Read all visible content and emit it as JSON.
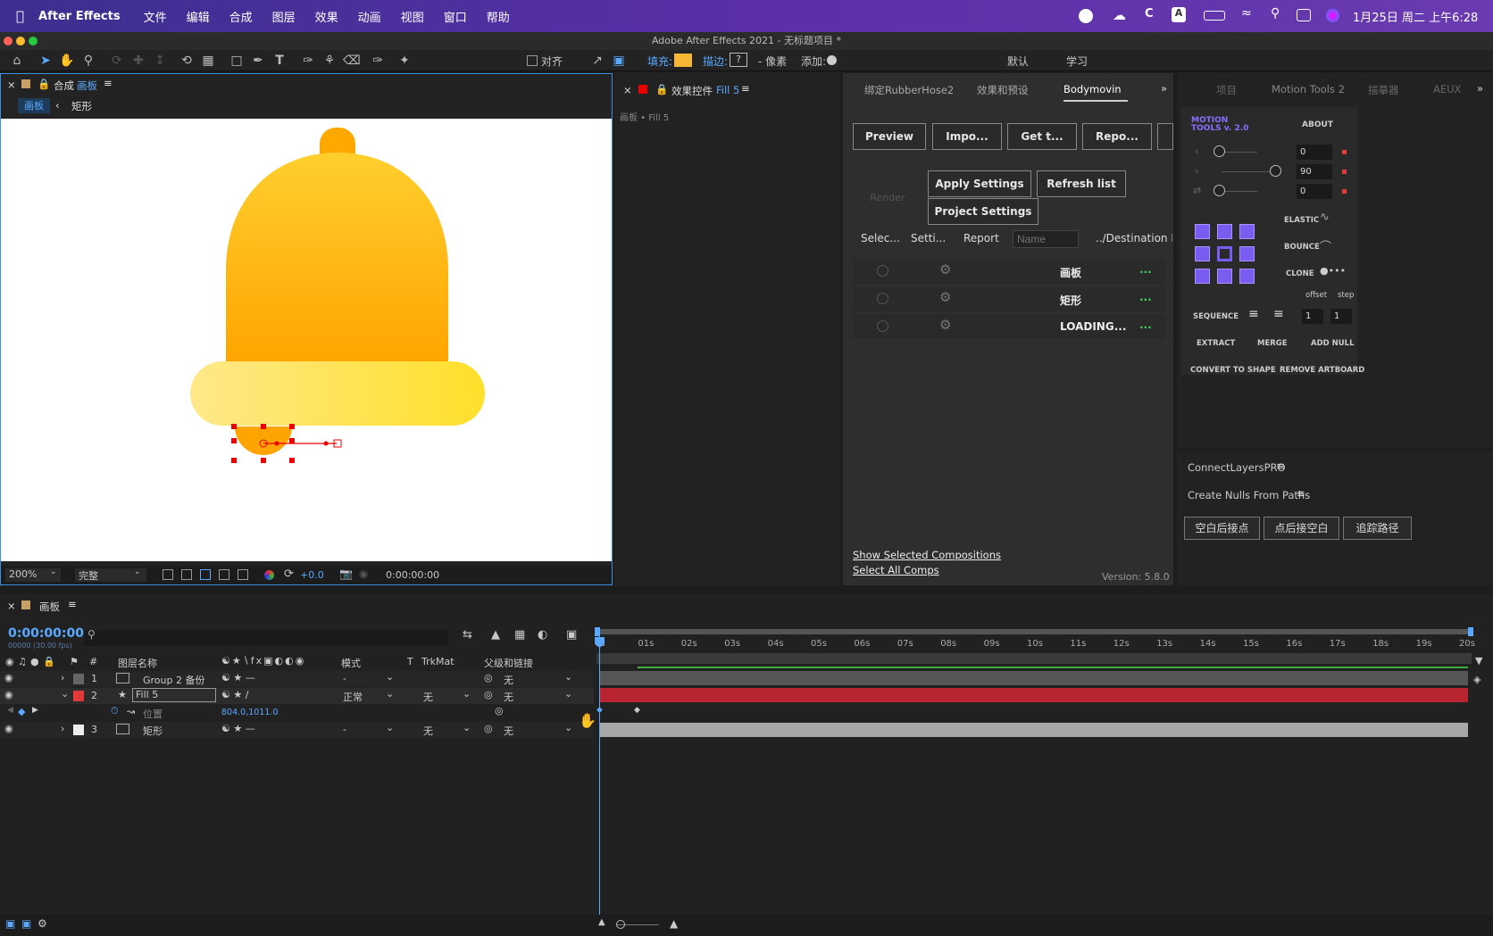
{
  "menubar": {
    "app": "After Effects",
    "items": [
      "文件",
      "编辑",
      "合成",
      "图层",
      "效果",
      "动画",
      "视图",
      "窗口",
      "帮助"
    ],
    "clock": "1月25日 周二 上午6:28"
  },
  "window": {
    "title": "Adobe After Effects 2021 - 无标题项目 *"
  },
  "toolbar": {
    "align": "对齐",
    "fill": "填充:",
    "stroke": "描边:",
    "stroke_value": "?",
    "pixels": "- 像素",
    "add": "添加:",
    "workspace_default": "默认",
    "workspace_learn": "学习"
  },
  "comp": {
    "tab_prefix": "合成",
    "tab_name": "画板",
    "crumb_1": "画板",
    "crumb_2": "矩形",
    "zoom": "200%",
    "quality": "完整",
    "exposure": "+0.0",
    "timecode": "0:00:00:00"
  },
  "effects": {
    "tab_prefix": "效果控件",
    "tab_name": "Fill 5",
    "sub": "画板 • Fill 5"
  },
  "bodymovin": {
    "tabs": [
      "绑定RubberHose2",
      "效果和预设",
      "Bodymovin"
    ],
    "buttons": [
      "Preview",
      "Impo...",
      "Get t...",
      "Repo..."
    ],
    "render": "Render",
    "apply": "Apply Settings",
    "refresh": "Refresh list",
    "project": "Project Settings",
    "cols": [
      "Selec...",
      "Setti...",
      "Report"
    ],
    "name_ph": "Name",
    "dest": "../Destination F",
    "rows": [
      "画板",
      "矩形",
      "LOADING..."
    ],
    "dots": "...",
    "show": "Show Selected Compositions",
    "select": "Select All Comps",
    "version": "Version: 5.8.0"
  },
  "motion": {
    "tabs": [
      "项目",
      "Motion Tools 2",
      "描摹器",
      "AEUX"
    ],
    "logo_1": "MOTION",
    "logo_2": "TOOLS v. 2.0",
    "about": "ABOUT",
    "v1": "0",
    "v2": "90",
    "v3": "0",
    "elastic": "ELASTIC",
    "bounce": "BOUNCE",
    "clone": "CLONE",
    "offset": "offset",
    "step": "step",
    "sequence": "SEQUENCE",
    "s1": "1",
    "s2": "1",
    "extract": "EXTRACT",
    "merge": "MERGE",
    "addnull": "ADD NULL",
    "convert": "CONVERT TO SHAPE",
    "remove": "REMOVE ARTBOARD"
  },
  "connect": {
    "title": "ConnectLayersPRO",
    "sub": "Create Nulls From Paths",
    "btns": [
      "空白后接点",
      "点后接空白",
      "追踪路径"
    ]
  },
  "timeline": {
    "tab": "画板",
    "timecode": "0:00:00:00",
    "fps": "00000 (30.00 fps)",
    "cols": {
      "num": "#",
      "name": "图层名称",
      "mode": "模式",
      "t": "T",
      "trkmat": "TrkMat",
      "parent": "父级和链接"
    },
    "layers": [
      {
        "num": "1",
        "name": "Group 2 备份",
        "mode": "-",
        "trk": "",
        "parent": "无",
        "color": "#666666"
      },
      {
        "num": "2",
        "name": "Fill 5",
        "mode": "正常",
        "trk": "无",
        "parent": "无",
        "color": "#e23a3a"
      },
      {
        "num": "3",
        "name": "矩形",
        "mode": "-",
        "trk": "无",
        "parent": "无",
        "color": "#eeeeee"
      }
    ],
    "prop": {
      "name": "位置",
      "value": "804.0,1011.0"
    },
    "ticks": [
      "0s",
      "01s",
      "02s",
      "03s",
      "04s",
      "05s",
      "06s",
      "07s",
      "08s",
      "09s",
      "10s",
      "11s",
      "12s",
      "13s",
      "14s",
      "15s",
      "16s",
      "17s",
      "18s",
      "19s",
      "20s"
    ]
  }
}
